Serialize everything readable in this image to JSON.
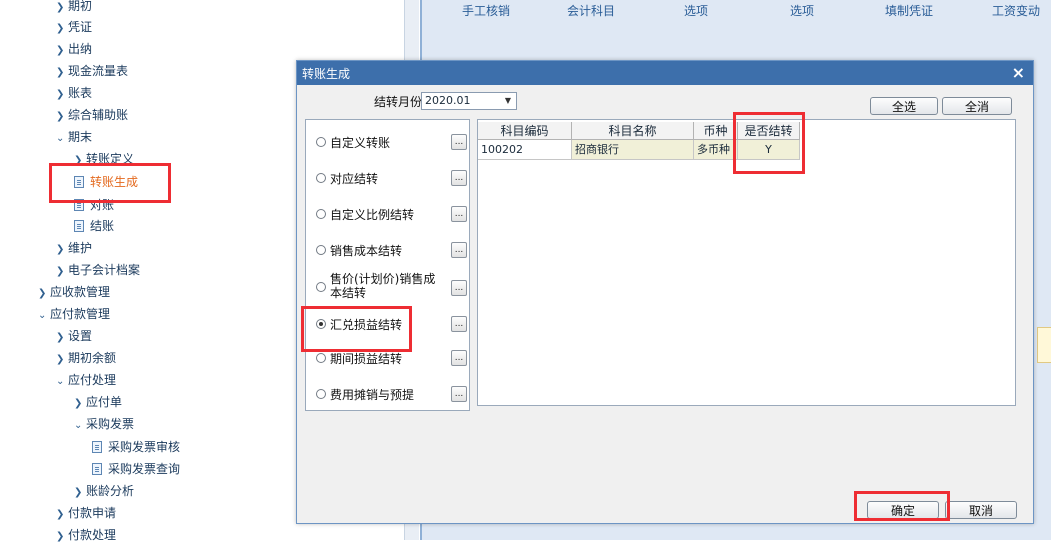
{
  "tree": {
    "items": [
      {
        "label": "期初",
        "type": "folder"
      },
      {
        "label": "凭证",
        "type": "folder"
      },
      {
        "label": "出纳",
        "type": "folder"
      },
      {
        "label": "现金流量表",
        "type": "folder"
      },
      {
        "label": "账表",
        "type": "folder"
      },
      {
        "label": "综合辅助账",
        "type": "folder"
      },
      {
        "label": "期末",
        "type": "folder-open"
      },
      {
        "label": "转账定义",
        "type": "folder"
      },
      {
        "label": "转账生成",
        "type": "doc"
      },
      {
        "label": "对账",
        "type": "doc"
      },
      {
        "label": "结账",
        "type": "doc"
      },
      {
        "label": "维护",
        "type": "folder"
      },
      {
        "label": "电子会计档案",
        "type": "folder"
      },
      {
        "label": "应收款管理",
        "type": "folder"
      },
      {
        "label": "应付款管理",
        "type": "folder-open"
      },
      {
        "label": "设置",
        "type": "folder"
      },
      {
        "label": "期初余额",
        "type": "folder"
      },
      {
        "label": "应付处理",
        "type": "folder-open"
      },
      {
        "label": "应付单",
        "type": "folder"
      },
      {
        "label": "采购发票",
        "type": "folder-open"
      },
      {
        "label": "采购发票审核",
        "type": "doc"
      },
      {
        "label": "采购发票查询",
        "type": "doc"
      },
      {
        "label": "账龄分析",
        "type": "folder"
      },
      {
        "label": "付款申请",
        "type": "folder"
      },
      {
        "label": "付款处理",
        "type": "folder"
      }
    ]
  },
  "topbar": {
    "items": [
      "手工核销",
      "会计科目",
      "选项",
      "选项",
      "填制凭证",
      "工资变动"
    ]
  },
  "dialog": {
    "title": "转账生成",
    "close": "×",
    "month_label": "结转月份",
    "month_value": "2020.01",
    "select_all": "全选",
    "deselect_all": "全消",
    "options": [
      {
        "label": "自定义转账",
        "selected": false
      },
      {
        "label": "对应结转",
        "selected": false
      },
      {
        "label": "自定义比例结转",
        "selected": false
      },
      {
        "label": "销售成本结转",
        "selected": false
      },
      {
        "label": "售价(计划价)销售成本结转",
        "selected": false
      },
      {
        "label": "汇兑损益结转",
        "selected": true
      },
      {
        "label": "期间损益结转",
        "selected": false
      },
      {
        "label": "费用摊销与预提",
        "selected": false
      }
    ],
    "ellipsis": "...",
    "grid": {
      "headers": [
        "科目编码",
        "科目名称",
        "币种",
        "是否结转"
      ],
      "rows": [
        [
          "100202",
          "招商银行",
          "多币种",
          "Y"
        ]
      ]
    },
    "ok": "确定",
    "cancel": "取消"
  },
  "colors": {
    "title_bar": "#3d6fab",
    "highlight": "#ee2d33",
    "active_item": "#e46a1f"
  }
}
